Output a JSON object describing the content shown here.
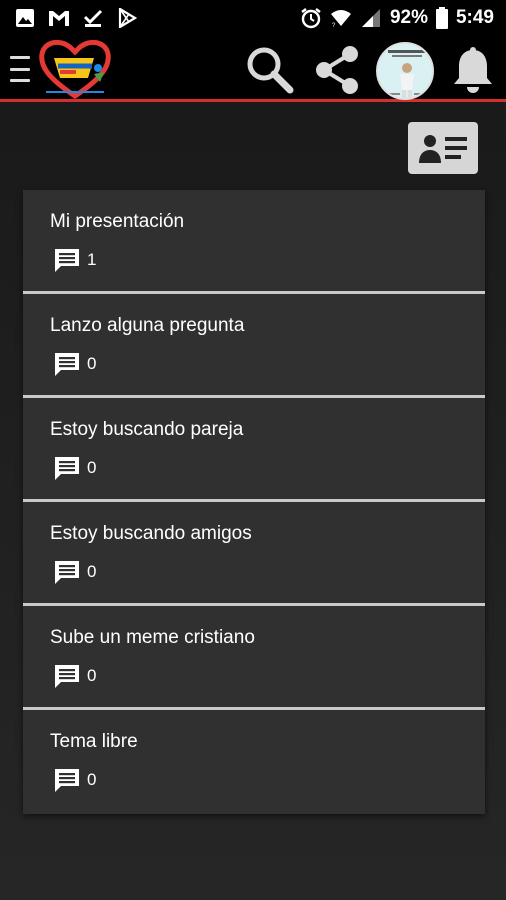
{
  "status_bar": {
    "battery_percent": "92%",
    "time": "5:49",
    "left_icons": [
      "image-icon",
      "gmail-icon",
      "download-done-icon",
      "play-store-icon"
    ],
    "right_icons": [
      "alarm-icon",
      "wifi-icon",
      "cell-signal-icon",
      "battery-icon"
    ]
  },
  "app_bar": {
    "accent_color": "#d32f2f",
    "icons": [
      "menu-icon",
      "app-logo",
      "search-icon",
      "share-icon",
      "avatar",
      "bell-icon"
    ]
  },
  "profile_button": {
    "icon": "contact-card-icon"
  },
  "topics": [
    {
      "title": "Mi presentación",
      "comments": "1"
    },
    {
      "title": "Lanzo alguna pregunta",
      "comments": "0"
    },
    {
      "title": "Estoy buscando pareja",
      "comments": "0"
    },
    {
      "title": "Estoy buscando amigos",
      "comments": "0"
    },
    {
      "title": "Sube un meme cristiano",
      "comments": "0"
    },
    {
      "title": "Tema libre",
      "comments": "0"
    }
  ]
}
